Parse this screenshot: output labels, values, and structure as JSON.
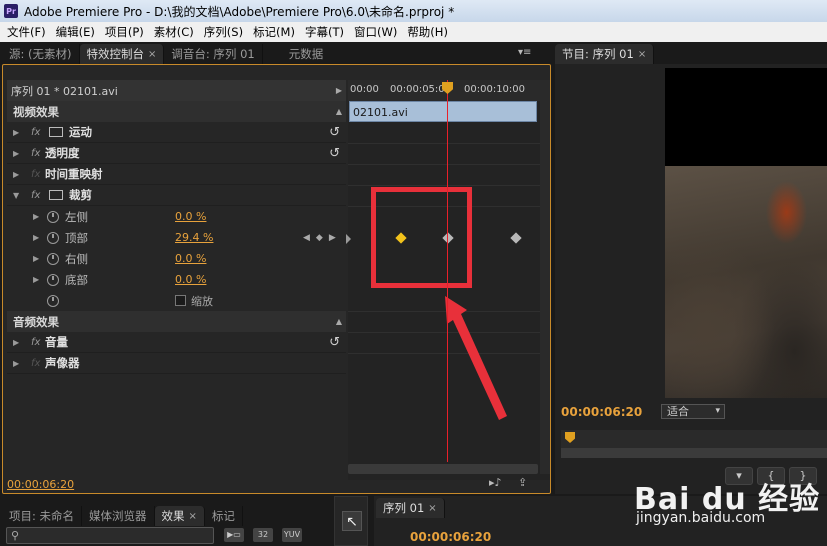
{
  "window": {
    "title": "Adobe Premiere Pro - D:\\我的文档\\Adobe\\Premiere Pro\\6.0\\未命名.prproj *",
    "icon_text": "Pr"
  },
  "menu": [
    "文件(F)",
    "编辑(E)",
    "项目(P)",
    "素材(C)",
    "序列(S)",
    "标记(M)",
    "字幕(T)",
    "窗口(W)",
    "帮助(H)"
  ],
  "source_tabs": [
    {
      "label": "源: (无素材)"
    },
    {
      "label": "特效控制台",
      "close": "×"
    },
    {
      "label": "调音台: 序列 01"
    },
    {
      "label": "元数据"
    }
  ],
  "effect_controls": {
    "sequence_header": "序列 01 * 02101.avi",
    "video_effects_header": "视频效果",
    "audio_effects_header": "音频效果",
    "effects": [
      {
        "name": "运动"
      },
      {
        "name": "透明度"
      },
      {
        "name": "时间重映射"
      },
      {
        "name": "裁剪"
      }
    ],
    "crop_params": [
      {
        "name": "左侧",
        "value": "0.0 %"
      },
      {
        "name": "顶部",
        "value": "29.4 %"
      },
      {
        "name": "右侧",
        "value": "0.0 %"
      },
      {
        "name": "底部",
        "value": "0.0 %"
      }
    ],
    "zoom_label": "缩放",
    "audio_effects": [
      {
        "name": "音量"
      },
      {
        "name": "声像器"
      }
    ],
    "current_time": "00:00:06:20",
    "timeline": {
      "ruler_labels": [
        "00:00",
        "00:00:05:00",
        "00:00:10:00"
      ],
      "clip_name": "02101.avi"
    }
  },
  "program_monitor": {
    "tab_label": "节目: 序列 01",
    "tab_close": "×",
    "timecode": "00:00:06:20",
    "fit_label": "适合"
  },
  "bottom": {
    "tabs": [
      {
        "label": "项目: 未命名"
      },
      {
        "label": "媒体浏览器"
      },
      {
        "label": "效果"
      },
      {
        "label": "标记"
      }
    ],
    "icons": [
      "32",
      "YUV"
    ],
    "sequence_tab": "序列 01",
    "sequence_time": "00:00:06:20"
  },
  "watermark": {
    "brand": "Bai du 经验",
    "url": "jingyan.baidu.com"
  },
  "colors": {
    "timecode": "#e8a23c",
    "highlight": "#e8303a",
    "keyframe_active": "#f2c21b",
    "panel_border": "#c88a2a"
  }
}
